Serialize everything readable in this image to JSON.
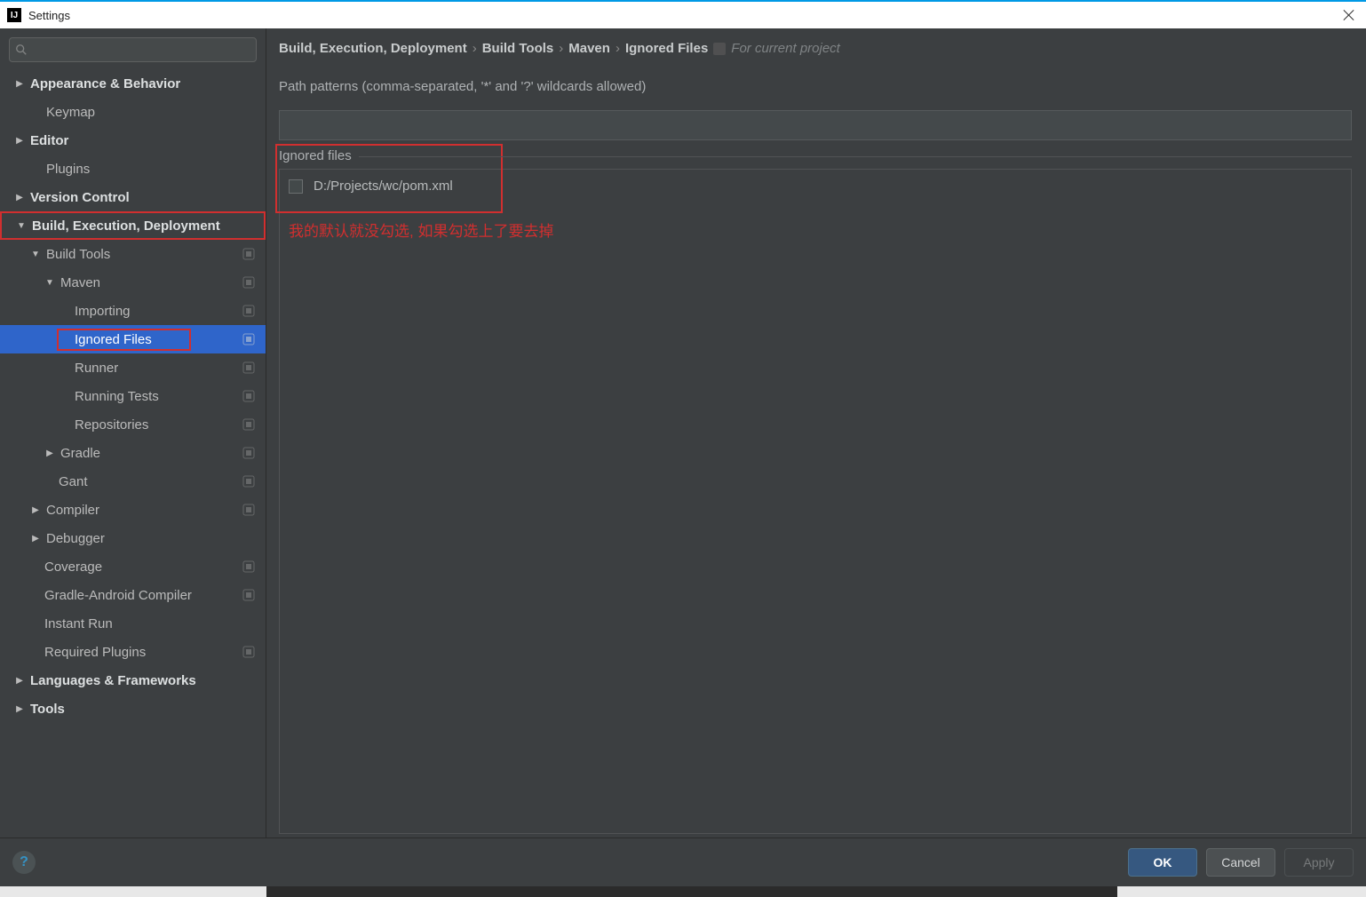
{
  "window": {
    "title": "Settings"
  },
  "sidebar": {
    "search_placeholder": "",
    "items": {
      "appearance": "Appearance & Behavior",
      "keymap": "Keymap",
      "editor": "Editor",
      "plugins": "Plugins",
      "vcs": "Version Control",
      "bed": "Build, Execution, Deployment",
      "buildtools": "Build Tools",
      "maven": "Maven",
      "importing": "Importing",
      "ignored": "Ignored Files",
      "runner": "Runner",
      "runtests": "Running Tests",
      "repos": "Repositories",
      "gradle": "Gradle",
      "gant": "Gant",
      "compiler": "Compiler",
      "debugger": "Debugger",
      "coverage": "Coverage",
      "gac": "Gradle-Android Compiler",
      "instant": "Instant Run",
      "reqplugins": "Required Plugins",
      "langs": "Languages & Frameworks",
      "tools": "Tools"
    }
  },
  "crumb": {
    "a": "Build, Execution, Deployment",
    "b": "Build Tools",
    "c": "Maven",
    "d": "Ignored Files",
    "scope": "For current project"
  },
  "main": {
    "patterns_label": "Path patterns (comma-separated, '*' and '?' wildcards allowed)",
    "patterns_value": "",
    "ignored_header": "Ignored files",
    "ignored_items": [
      {
        "path": "D:/Projects/wc/pom.xml",
        "checked": false
      }
    ],
    "annotation": "我的默认就没勾选, 如果勾选上了要去掉"
  },
  "footer": {
    "ok": "OK",
    "cancel": "Cancel",
    "apply": "Apply"
  }
}
